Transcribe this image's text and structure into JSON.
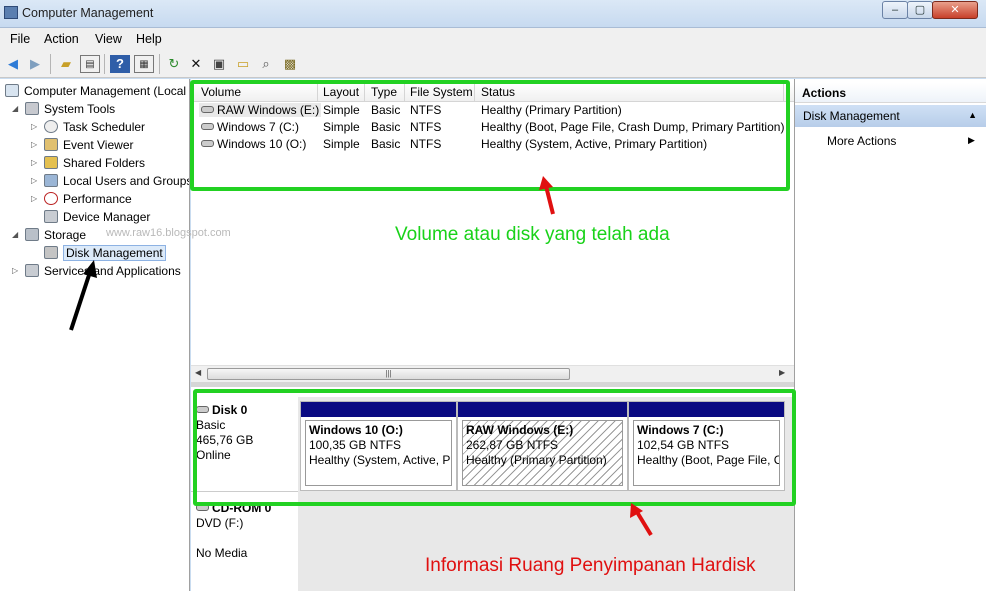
{
  "window": {
    "title": "Computer Management",
    "min_label": "–",
    "max_label": "▢",
    "close_label": "✕"
  },
  "menu": [
    "File",
    "Action",
    "View",
    "Help"
  ],
  "toolbar": [
    "back-icon",
    "forward-icon",
    "up-folder-icon",
    "show-hide-tree-icon",
    "help-icon",
    "console-icon",
    "refresh-icon",
    "delete-icon",
    "properties-icon",
    "open-icon",
    "search-icon",
    "settings-icon"
  ],
  "tree": {
    "root": "Computer Management (Local",
    "system_tools": "System Tools",
    "task_scheduler": "Task Scheduler",
    "event_viewer": "Event Viewer",
    "shared_folders": "Shared Folders",
    "local_users": "Local Users and Groups",
    "performance": "Performance",
    "device_manager": "Device Manager",
    "storage": "Storage",
    "disk_management": "Disk Management",
    "services": "Services and Applications"
  },
  "watermark": "www.raw16.blogspot.com",
  "volumes": {
    "headers": [
      "Volume",
      "Layout",
      "Type",
      "File System",
      "Status"
    ],
    "rows": [
      [
        "RAW Windows (E:)",
        "Simple",
        "Basic",
        "NTFS",
        "Healthy (Primary Partition)"
      ],
      [
        "Windows 7 (C:)",
        "Simple",
        "Basic",
        "NTFS",
        "Healthy (Boot, Page File, Crash Dump, Primary Partition)"
      ],
      [
        "Windows 10 (O:)",
        "Simple",
        "Basic",
        "NTFS",
        "Healthy (System, Active, Primary Partition)"
      ]
    ]
  },
  "disk0": {
    "name": "Disk 0",
    "type": "Basic",
    "size": "465,76 GB",
    "status": "Online",
    "partitions": [
      {
        "name": "Windows 10  (O:)",
        "size": "100,35 GB NTFS",
        "status": "Healthy (System, Active, Pr"
      },
      {
        "name": "RAW Windows  (E:)",
        "size": "262,87 GB NTFS",
        "status": "Healthy (Primary Partition)"
      },
      {
        "name": "Windows 7  (C:)",
        "size": "102,54 GB NTFS",
        "status": "Healthy (Boot, Page File, Cr"
      }
    ]
  },
  "cdrom": {
    "name": "CD-ROM 0",
    "drive": "DVD (F:)",
    "media": "No Media"
  },
  "actions": {
    "header": "Actions",
    "section": "Disk Management",
    "more": "More Actions"
  },
  "annotations": {
    "top_text": "Volume atau disk yang telah ada",
    "bottom_text": "Informasi Ruang Penyimpanan Hardisk",
    "box_color": "#22d122",
    "arrow_color_red": "#e01010",
    "arrow_color_black": "#000000"
  },
  "colors": {
    "partition_bar": "#0a0a82",
    "selection": "#dceaf9",
    "actions_header": "#b7cde9"
  }
}
